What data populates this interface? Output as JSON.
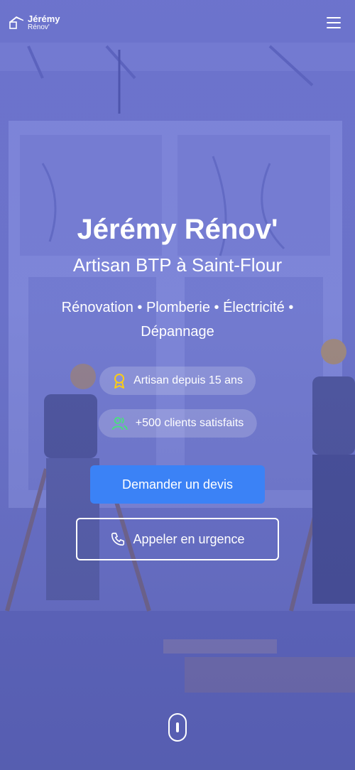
{
  "nav": {
    "logo_name": "Jérémy",
    "logo_sub": "Rénov'",
    "menu_icon": "hamburger-menu-icon"
  },
  "hero": {
    "title": "Jérémy Rénov'",
    "subtitle": "Artisan BTP à Saint-Flour",
    "services": "Rénovation • Plomberie • Électricité • Dépannage"
  },
  "badges": [
    {
      "icon": "award-icon",
      "label": "Artisan depuis 15 ans",
      "color": "#facc15"
    },
    {
      "icon": "users-icon",
      "label": "+500 clients satisfaits",
      "color": "#4ade80"
    }
  ],
  "cta": {
    "primary_label": "Demander un devis",
    "secondary_label": "Appeler en urgence",
    "secondary_icon": "phone-icon"
  },
  "colors": {
    "accent": "#3b82f6",
    "overlay": "#6068d2"
  }
}
